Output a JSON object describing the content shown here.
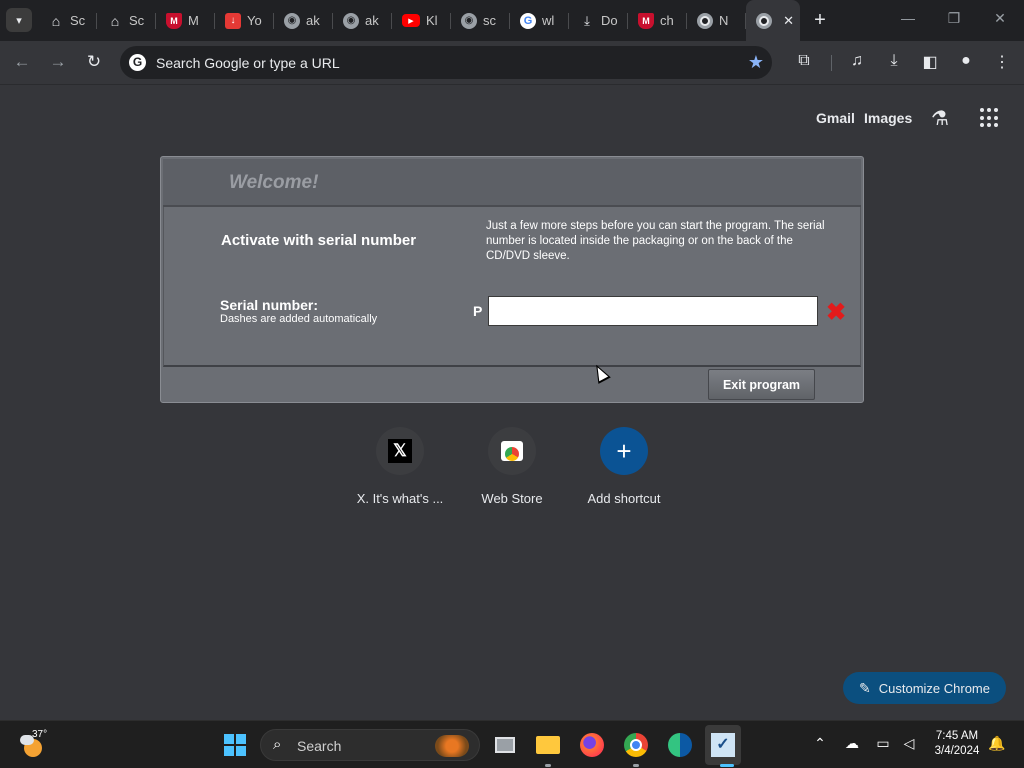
{
  "browser": {
    "tabs": [
      {
        "title": "Sc",
        "icon": "bank-icon"
      },
      {
        "title": "Sc",
        "icon": "bank-icon"
      },
      {
        "title": "M",
        "icon": "mcafee-icon"
      },
      {
        "title": "Yo",
        "icon": "download-icon"
      },
      {
        "title": "ak",
        "icon": "globe-icon"
      },
      {
        "title": "ak",
        "icon": "globe-icon"
      },
      {
        "title": "Kl",
        "icon": "youtube-icon"
      },
      {
        "title": "sc",
        "icon": "globe-icon"
      },
      {
        "title": "wl",
        "icon": "google-icon"
      },
      {
        "title": "Do",
        "icon": "download-icon"
      },
      {
        "title": "ch",
        "icon": "mcafee-icon"
      },
      {
        "title": "N",
        "icon": "chrome-icon"
      },
      {
        "title": "",
        "icon": "chrome-icon",
        "active": true
      }
    ],
    "omnibox_placeholder": "Search Google or type a URL",
    "top_links": {
      "gmail": "Gmail",
      "images": "Images"
    },
    "shortcuts": [
      {
        "label": "X. It's what's ...",
        "icon": "x-logo-icon"
      },
      {
        "label": "Web Store",
        "icon": "web-store-icon"
      },
      {
        "label": "Add shortcut",
        "icon": "plus-icon"
      }
    ],
    "customize_label": "Customize Chrome",
    "accent_color": "#8ab4f8"
  },
  "dialog": {
    "title": "Welcome!",
    "heading": "Activate with serial number",
    "instructions": "Just a few more steps before you can start the program. The serial number is located inside the packaging or on the back of the CD/DVD sleeve.",
    "serial_label": "Serial number:",
    "serial_hint": "Dashes are added automatically",
    "serial_prefix": "P",
    "serial_value": "",
    "exit_label": "Exit program",
    "clear_color": "#e31b1b"
  },
  "taskbar": {
    "temperature": "37°",
    "search_label": "Search",
    "time": "7:45 AM",
    "date": "3/4/2024"
  }
}
